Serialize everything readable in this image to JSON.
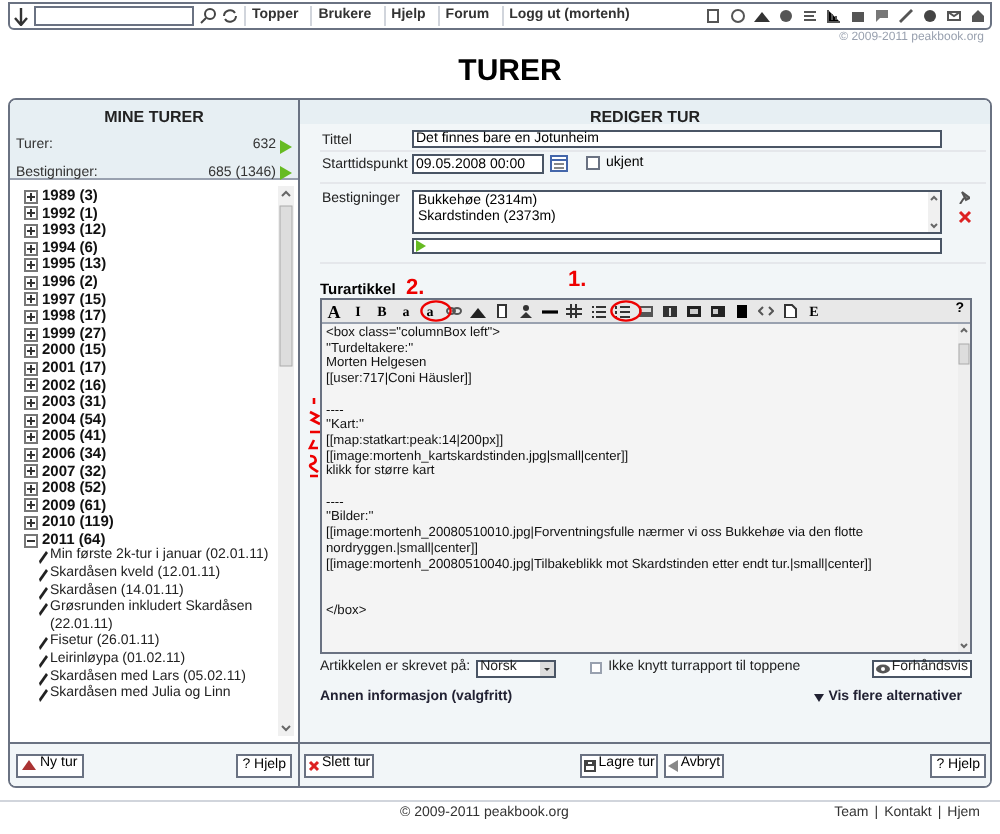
{
  "top_bar": {
    "links": [
      "Topper",
      "Brukere",
      "Hjelp",
      "Forum",
      "Logg ut (mortenh)"
    ]
  },
  "copyright_top": "© 2009-2011 peakbook.org",
  "page_title": "TURER",
  "left_panel": {
    "title": "MINE TURER",
    "stats": [
      {
        "label": "Turer:",
        "value": "632"
      },
      {
        "label": "Bestigninger:",
        "value": "685 (1346)"
      }
    ],
    "tree": [
      {
        "label": "1989 (3)",
        "expanded": false
      },
      {
        "label": "1992 (1)",
        "expanded": false
      },
      {
        "label": "1993 (12)",
        "expanded": false
      },
      {
        "label": "1994 (6)",
        "expanded": false
      },
      {
        "label": "1995 (13)",
        "expanded": false
      },
      {
        "label": "1996 (2)",
        "expanded": false
      },
      {
        "label": "1997 (15)",
        "expanded": false
      },
      {
        "label": "1998 (17)",
        "expanded": false
      },
      {
        "label": "1999 (27)",
        "expanded": false
      },
      {
        "label": "2000 (15)",
        "expanded": false
      },
      {
        "label": "2001 (17)",
        "expanded": false
      },
      {
        "label": "2002 (16)",
        "expanded": false
      },
      {
        "label": "2003 (31)",
        "expanded": false
      },
      {
        "label": "2004 (54)",
        "expanded": false
      },
      {
        "label": "2005 (41)",
        "expanded": false
      },
      {
        "label": "2006 (34)",
        "expanded": false
      },
      {
        "label": "2007 (32)",
        "expanded": false
      },
      {
        "label": "2008 (52)",
        "expanded": false
      },
      {
        "label": "2009 (61)",
        "expanded": false
      },
      {
        "label": "2010 (119)",
        "expanded": false
      },
      {
        "label": "2011 (64)",
        "expanded": true,
        "children": [
          {
            "label": "Min første 2k-tur i januar (02.01.11)"
          },
          {
            "label": "Skardåsen kveld (12.01.11)"
          },
          {
            "label": "Skardåsen (14.01.11)"
          },
          {
            "label": "Grøsrunden inkludert Skardåsen (22.01.11)"
          },
          {
            "label": "Fisetur (26.01.11)"
          },
          {
            "label": "Leirinløypa (01.02.11)"
          },
          {
            "label": "Skardåsen med Lars (05.02.11)"
          },
          {
            "label": "Skardåsen med Julia og Linn"
          }
        ]
      }
    ],
    "buttons": [
      "Ny tur",
      "? Hjelp"
    ]
  },
  "right_panel": {
    "title": "REDIGER TUR",
    "title_field": {
      "label": "Tittel",
      "value": "Det finnes bare en Jotunheim"
    },
    "start_field": {
      "label": "Starttidspunkt",
      "value": "09.05.2008 00:00",
      "unknown": {
        "label": "ukjent",
        "checked": false
      }
    },
    "ascents": {
      "label": "Bestigninger",
      "items": [
        "Bukkehøe (2314m)",
        "Skardstinden (2373m)"
      ]
    },
    "article": {
      "label": "Turartikkel",
      "toolbar": [
        {
          "kind": "glyph",
          "label": "A"
        },
        {
          "kind": "glyph",
          "label": "I"
        },
        {
          "kind": "glyph",
          "label": "B"
        },
        {
          "kind": "glyph",
          "label": "a"
        },
        {
          "kind": "glyph",
          "label": "a"
        },
        {
          "kind": "icon"
        },
        {
          "kind": "icon"
        },
        {
          "kind": "icon"
        },
        {
          "kind": "icon"
        },
        {
          "kind": "icon"
        },
        {
          "kind": "icon"
        },
        {
          "kind": "icon"
        },
        {
          "kind": "icon"
        },
        {
          "kind": "icon"
        },
        {
          "kind": "icon"
        },
        {
          "kind": "icon"
        },
        {
          "kind": "icon"
        },
        {
          "kind": "icon"
        },
        {
          "kind": "icon"
        },
        {
          "kind": "icon"
        },
        {
          "kind": "glyph",
          "label": "E"
        },
        {
          "kind": "help",
          "label": "?"
        }
      ],
      "text": "<box class=\"columnBox left\">\n''Turdeltakere:''\nMorten Helgesen\n[[user:717|Coni Häusler]]\n\n----\n''Kart:''\n[[map:statkart:peak:14|200px]]\n[[image:mortenh_kartskardstinden.jpg|small|center]]\nklikk for større kart\n\n----\n''Bilder:''\n[[image:mortenh_20080510010.jpg|Forventningsfulle nærmer vi oss Bukkehøe via den flotte nordryggen.|small|center]]\n[[image:mortenh_20080510040.jpg|Tilbakeblikk mot Skardstinden etter endt tur.|small|center]]\n\n\n</box>",
      "language_label": "Artikkelen er skrevet på:",
      "language": "Norsk",
      "detach": {
        "label": "Ikke knytt turrapport til toppene",
        "checked": false
      },
      "preview": "Forhåndsvis"
    },
    "other_info": "Annen informasjon (valgfritt)",
    "more": {
      "label": "Vis flere alternativer",
      "expanded": false
    },
    "buttons": {
      "delete": "Slett tur",
      "save": "Lagre tur",
      "cancel": "Avbryt",
      "help": "? Hjelp"
    }
  },
  "annotations": [
    "2.",
    "1."
  ],
  "footer": {
    "copyright": "© 2009-2011 peakbook.org",
    "links": [
      "Team",
      "Kontakt",
      "Hjem"
    ],
    "separator": "|"
  }
}
